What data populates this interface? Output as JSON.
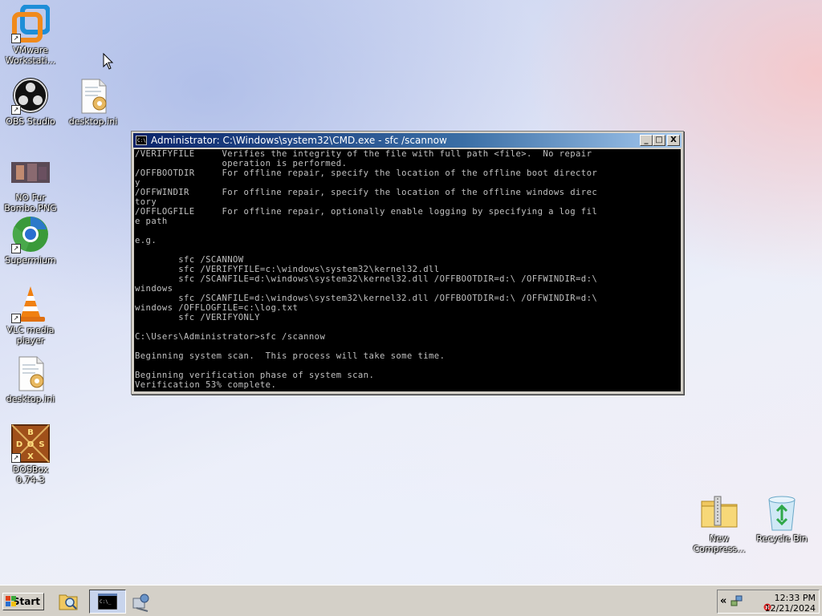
{
  "desktop_icons": {
    "vmware": "VMware\nWorkstati...",
    "obs": "OBS Studio",
    "desktop_ini_1": "desktop.ini",
    "no_fur": "NO Fur\nBombo.PNG",
    "supermium": "Supermium",
    "vlc": "VLC media\nplayer",
    "desktop_ini_2": "desktop.ini",
    "dosbox": "DOSBox 0.74-3",
    "new_compressed": "New\nCompress...",
    "recycle_bin": "Recycle Bin"
  },
  "cmd_window": {
    "title": "Administrator: C:\\Windows\\system32\\CMD.exe - sfc  /scannow",
    "minimize": "_",
    "maximize": "□",
    "close": "X",
    "console_text": "/VERIFYFILE     Verifies the integrity of the file with full path <file>.  No repair\n                operation is performed.\n/OFFBOOTDIR     For offline repair, specify the location of the offline boot director\ny\n/OFFWINDIR      For offline repair, specify the location of the offline windows direc\ntory\n/OFFLOGFILE     For offline repair, optionally enable logging by specifying a log fil\ne path\n\ne.g.\n\n        sfc /SCANNOW\n        sfc /VERIFYFILE=c:\\windows\\system32\\kernel32.dll\n        sfc /SCANFILE=d:\\windows\\system32\\kernel32.dll /OFFBOOTDIR=d:\\ /OFFWINDIR=d:\\\nwindows\n        sfc /SCANFILE=d:\\windows\\system32\\kernel32.dll /OFFBOOTDIR=d:\\ /OFFWINDIR=d:\\\nwindows /OFFLOGFILE=c:\\log.txt\n        sfc /VERIFYONLY\n\nC:\\Users\\Administrator>sfc /scannow\n\nBeginning system scan.  This process will take some time.\n\nBeginning verification phase of system scan.\nVerification 53% complete."
  },
  "taskbar": {
    "start_label": "Start",
    "tray_chevron": "«",
    "clock_time": "12:33 PM",
    "clock_date": "12/21/2024"
  }
}
